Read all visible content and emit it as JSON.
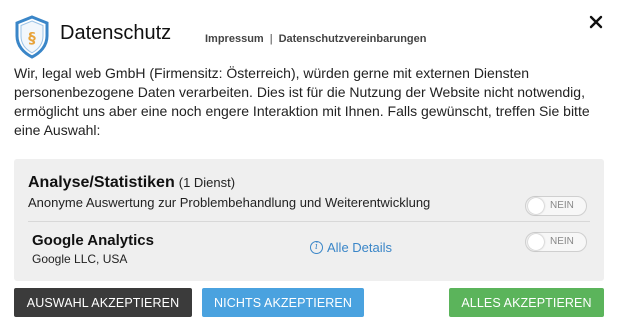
{
  "header": {
    "title": "Datenschutz",
    "logo_icon": "shield-paragraph-icon",
    "links": [
      "Impressum",
      "Datenschutzvereinbarungen"
    ],
    "link_separator": "|",
    "close_icon": "close-icon"
  },
  "intro": "Wir, legal web GmbH (Firmensitz: Österreich), würden gerne mit externen Diensten personenbezogene Daten verarbeiten. Dies ist für die Nutzung der Website nicht notwendig, ermöglicht uns aber eine noch engere Interaktion mit Ihnen. Falls gewünscht, treffen Sie bitte eine Auswahl:",
  "category": {
    "title": "Analyse/Statistiken",
    "count": "(1 Dienst)",
    "description": "Anonyme Auswertung zur Problembehandlung und Weiterentwicklung",
    "toggle_label": "NEIN",
    "toggle_on": false
  },
  "service": {
    "name": "Google Analytics",
    "company": "Google LLC, USA",
    "details_label": "Alle Details",
    "info_icon": "info-icon",
    "toggle_label": "NEIN",
    "toggle_on": false
  },
  "buttons": {
    "select": "AUSWAHL AKZEPTIEREN",
    "none": "NICHTS AKZEPTIEREN",
    "all": "ALLES AKZEPTIEREN"
  },
  "colors": {
    "select_bg": "#3b3b3b",
    "none_bg": "#4aa2df",
    "all_bg": "#5bb45b",
    "link": "#3a86c8",
    "shield_border": "#3a86c8",
    "shield_accent": "#e8a33a"
  }
}
